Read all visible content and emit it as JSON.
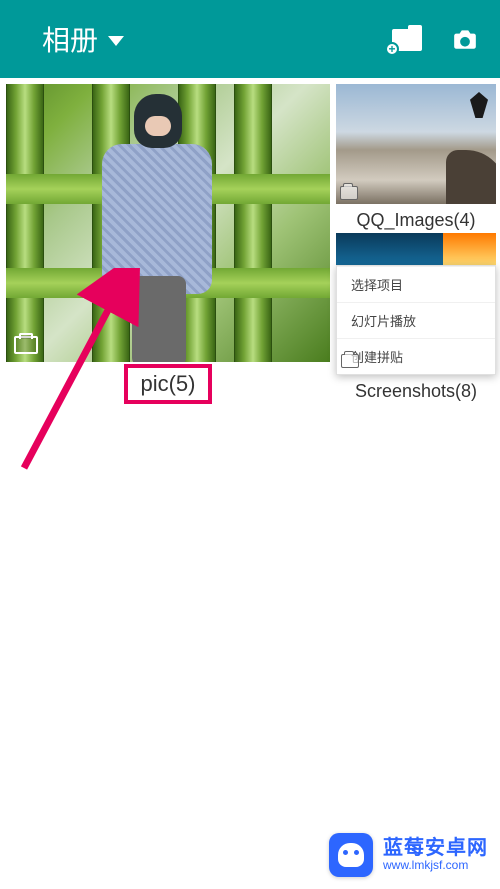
{
  "header": {
    "title": "相册"
  },
  "albums": {
    "pic": {
      "label": "pic(5)"
    },
    "qq": {
      "label": "QQ_Images(4)"
    },
    "screenshots": {
      "label": "Screenshots(8)"
    }
  },
  "context_menu": {
    "items": [
      "选择项目",
      "幻灯片播放",
      "创建拼贴"
    ]
  },
  "watermark": {
    "title": "蓝莓安卓网",
    "url": "www.lmkjsf.com"
  }
}
